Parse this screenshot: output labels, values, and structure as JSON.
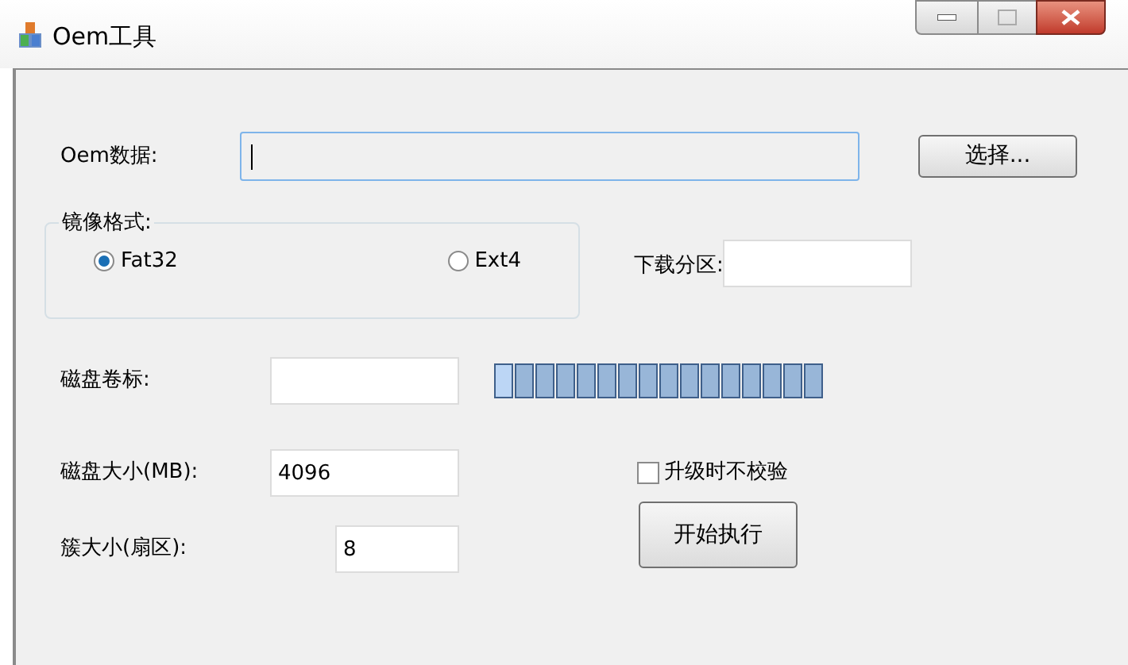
{
  "window": {
    "title": "Oem工具"
  },
  "oem_data": {
    "label": "Oem数据:",
    "focused": true,
    "button": "选择..."
  },
  "image_format": {
    "legend": "镜像格式:",
    "options": [
      {
        "label": "Fat32",
        "selected": true
      },
      {
        "label": "Ext4",
        "selected": false
      }
    ]
  },
  "download_partition": {
    "label": "下载分区:"
  },
  "disk_label": {
    "label": "磁盘卷标:"
  },
  "disk_size": {
    "label": "磁盘大小(MB):",
    "value": "4096"
  },
  "skip_verify": {
    "label": "升级时不校验",
    "checked": false
  },
  "cluster_size": {
    "label": "簇大小(扇区):",
    "value": "8"
  },
  "start_button": "开始执行"
}
